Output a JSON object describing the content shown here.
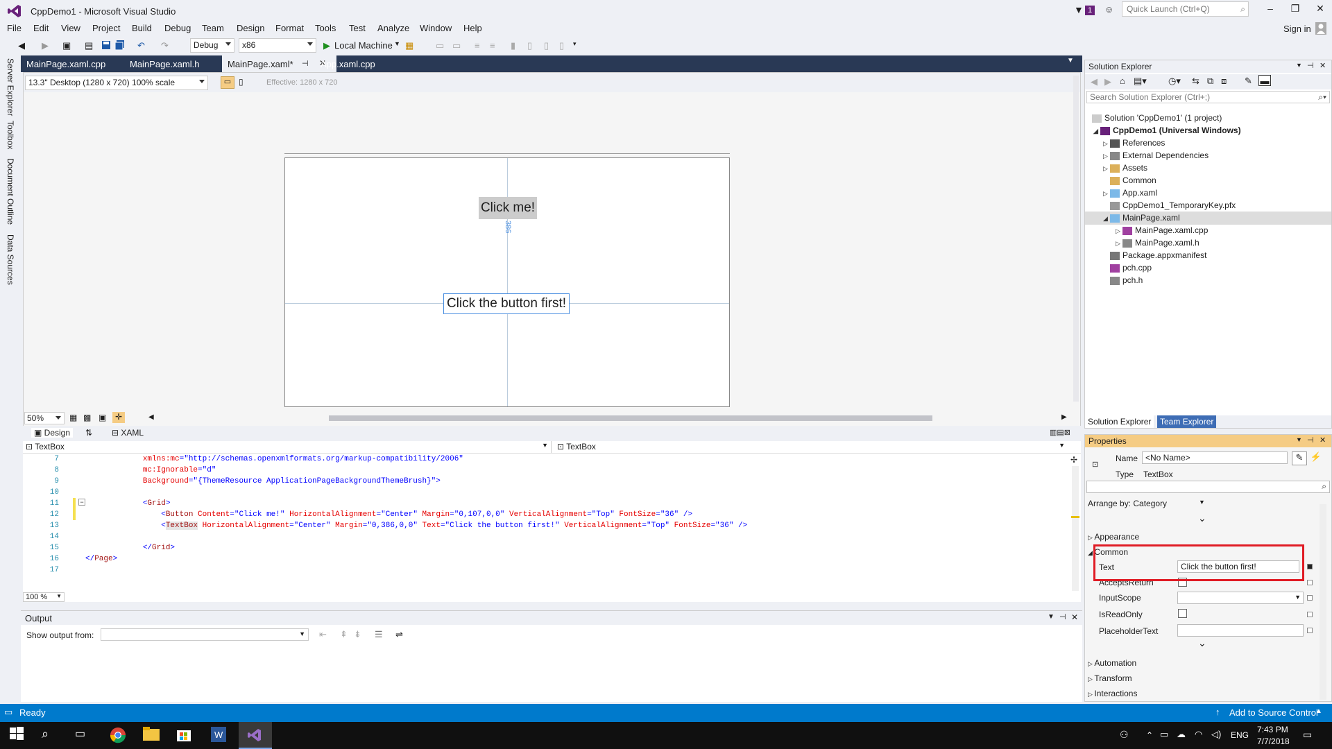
{
  "window": {
    "title": "CppDemo1 - Microsoft Visual Studio",
    "notifications": "1",
    "quick_launch_placeholder": "Quick Launch (Ctrl+Q)",
    "sign_in": "Sign in"
  },
  "menu": [
    "File",
    "Edit",
    "View",
    "Project",
    "Build",
    "Debug",
    "Team",
    "Design",
    "Format",
    "Tools",
    "Test",
    "Analyze",
    "Window",
    "Help"
  ],
  "toolbar": {
    "config": "Debug",
    "platform": "x86",
    "run": "Local Machine"
  },
  "side_tabs": [
    "Server Explorer",
    "Toolbox",
    "Document Outline",
    "Data Sources"
  ],
  "doc_tabs": [
    {
      "label": "MainPage.xaml.cpp"
    },
    {
      "label": "MainPage.xaml.h"
    },
    {
      "label": "MainPage.xaml*"
    },
    {
      "label": "App.xaml.cpp"
    }
  ],
  "designer": {
    "device": "13.3\" Desktop (1280 x 720) 100% scale",
    "effective": "Effective: 1280 x 720",
    "button_text": "Click me!",
    "textbox_text": "Click the button first!",
    "margin_label": "386",
    "zoom": "50%"
  },
  "split": {
    "design": "Design",
    "xaml": "XAML"
  },
  "editor": {
    "nav_left": "TextBox",
    "nav_right": "TextBox",
    "zoom": "100 %",
    "line_numbers": [
      "7",
      "8",
      "9",
      "10",
      "11",
      "12",
      "13",
      "14",
      "15",
      "16",
      "17"
    ]
  },
  "output": {
    "title": "Output",
    "show_from": "Show output from:"
  },
  "solution": {
    "title": "Solution Explorer",
    "search": "Search Solution Explorer (Ctrl+;)",
    "items": [
      "Solution 'CppDemo1' (1 project)",
      "CppDemo1 (Universal Windows)",
      "References",
      "External Dependencies",
      "Assets",
      "Common",
      "App.xaml",
      "CppDemo1_TemporaryKey.pfx",
      "MainPage.xaml",
      "MainPage.xaml.cpp",
      "MainPage.xaml.h",
      "Package.appxmanifest",
      "pch.cpp",
      "pch.h"
    ],
    "tab_solution": "Solution Explorer",
    "tab_team": "Team Explorer"
  },
  "properties": {
    "title": "Properties",
    "name_label": "Name",
    "name_value": "<No Name>",
    "type_label": "Type",
    "type_value": "TextBox",
    "arrange": "Arrange by: Category",
    "cat_appearance": "Appearance",
    "cat_common": "Common",
    "text_label": "Text",
    "text_value": "Click the button first!",
    "accepts_return": "AcceptsReturn",
    "input_scope": "InputScope",
    "is_read_only": "IsReadOnly",
    "placeholder": "PlaceholderText",
    "cat_automation": "Automation",
    "cat_transform": "Transform",
    "cat_interactions": "Interactions"
  },
  "status": {
    "left": "Ready",
    "right": "Add to Source Control"
  },
  "taskbar": {
    "lang": "ENG",
    "time": "7:43 PM",
    "date": "7/7/2018"
  }
}
